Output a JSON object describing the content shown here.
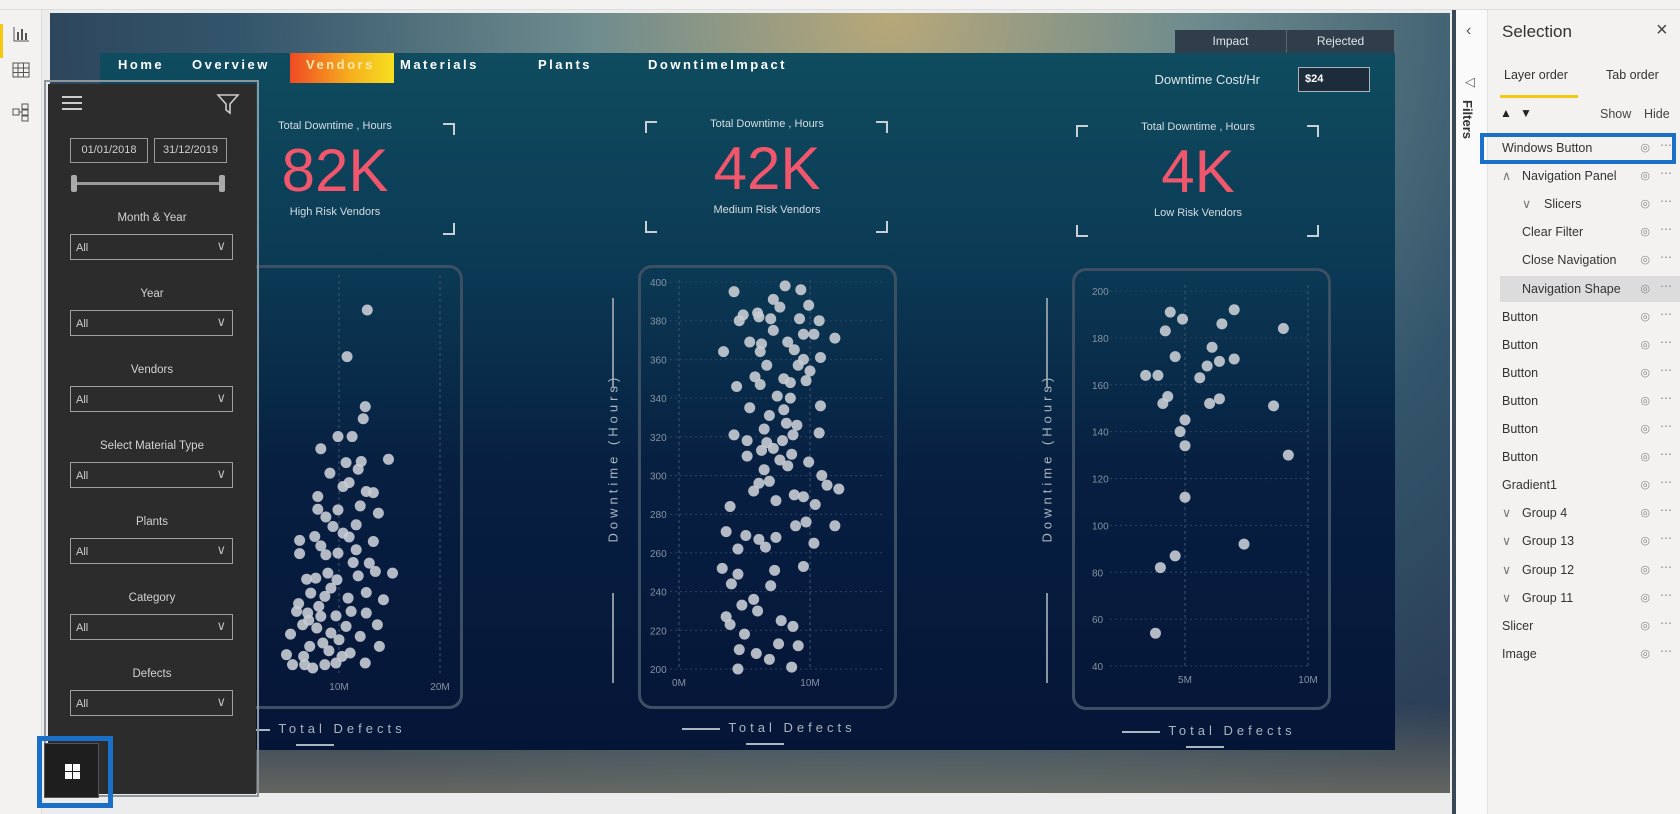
{
  "left_rail": {
    "icons": [
      "report-view-icon",
      "data-view-icon",
      "model-view-icon"
    ],
    "active": "report-view-icon"
  },
  "report": {
    "nav": {
      "items": [
        "Home",
        "Overview",
        "Vendors",
        "Materials",
        "Plants",
        "DowntimeImpact"
      ],
      "active": "Vendors"
    },
    "tabs": [
      "Impact",
      "Rejected"
    ],
    "cost": {
      "label": "Downtime Cost/Hr",
      "value": "$24"
    },
    "kpis": [
      {
        "title": "Total Downtime , Hours",
        "value": "82K",
        "subtitle": "High Risk Vendors"
      },
      {
        "title": "Total Downtime , Hours",
        "value": "42K",
        "subtitle": "Medium Risk Vendors"
      },
      {
        "title": "Total Downtime , Hours",
        "value": "4K",
        "subtitle": "Low Risk Vendors"
      }
    ],
    "accent_color": "#f0566c",
    "active_tab_gradient": [
      "#f04a24",
      "#f7df1f"
    ]
  },
  "slicer_panel": {
    "date_from": "01/01/2018",
    "date_to": "31/12/2019",
    "slicers": [
      {
        "label": "Month & Year",
        "value": "All"
      },
      {
        "label": "Year",
        "value": "All"
      },
      {
        "label": "Vendors",
        "value": "All"
      },
      {
        "label": "Select Material Type",
        "value": "All"
      },
      {
        "label": "Plants",
        "value": "All"
      },
      {
        "label": "Category",
        "value": "All"
      },
      {
        "label": "Defects",
        "value": "All"
      }
    ]
  },
  "filters_pane": {
    "label": "Filters"
  },
  "selection_pane": {
    "title": "Selection",
    "tabs": [
      "Layer order",
      "Tab order"
    ],
    "active_tab": "Layer order",
    "show_label": "Show",
    "hide_label": "Hide",
    "items": [
      {
        "label": "Windows Button",
        "indent": 0,
        "chevron": "",
        "selected": true
      },
      {
        "label": "Navigation Panel",
        "indent": 1,
        "chevron": "^"
      },
      {
        "label": "Slicers",
        "indent": 2,
        "chevron": "v"
      },
      {
        "label": "Clear Filter",
        "indent": 1,
        "chevron": ""
      },
      {
        "label": "Close Navigation",
        "indent": 1,
        "chevron": ""
      },
      {
        "label": "Navigation Shape",
        "indent": 1,
        "chevron": "",
        "shaded": true
      },
      {
        "label": "Button",
        "indent": 0,
        "chevron": ""
      },
      {
        "label": "Button",
        "indent": 0,
        "chevron": ""
      },
      {
        "label": "Button",
        "indent": 0,
        "chevron": ""
      },
      {
        "label": "Button",
        "indent": 0,
        "chevron": ""
      },
      {
        "label": "Button",
        "indent": 0,
        "chevron": ""
      },
      {
        "label": "Button",
        "indent": 0,
        "chevron": ""
      },
      {
        "label": "Gradient1",
        "indent": 0,
        "chevron": ""
      },
      {
        "label": "Group 4",
        "indent": 0,
        "chevron": "v"
      },
      {
        "label": "Group 13",
        "indent": 0,
        "chevron": "v"
      },
      {
        "label": "Group 12",
        "indent": 0,
        "chevron": "v"
      },
      {
        "label": "Group 11",
        "indent": 0,
        "chevron": "v"
      },
      {
        "label": "Slicer",
        "indent": 0,
        "chevron": ""
      },
      {
        "label": "Image",
        "indent": 0,
        "chevron": ""
      }
    ]
  },
  "chart_data": [
    {
      "type": "scatter",
      "title": "",
      "xlabel": "Total Defects",
      "ylabel": "",
      "xticks": [
        "10M",
        "20M"
      ],
      "yticks": [],
      "xlim": [
        0,
        20
      ],
      "ylim": [
        0,
        1308
      ],
      "grid": true,
      "point_color": "#c8ccd4",
      "points": [
        [
          12.8,
          1308
        ],
        [
          10.8,
          1140
        ],
        [
          12.6,
          960
        ],
        [
          12.4,
          916
        ],
        [
          9.9,
          852
        ],
        [
          11.3,
          852
        ],
        [
          8.2,
          808
        ],
        [
          14.9,
          770
        ],
        [
          10.7,
          758
        ],
        [
          12.2,
          762
        ],
        [
          11.9,
          734
        ],
        [
          9.1,
          720
        ],
        [
          11.0,
          686
        ],
        [
          10.4,
          672
        ],
        [
          7.9,
          636
        ],
        [
          12.7,
          654
        ],
        [
          13.4,
          650
        ],
        [
          12.1,
          602
        ],
        [
          13.9,
          576
        ],
        [
          7.9,
          590
        ],
        [
          9.9,
          588
        ],
        [
          8.7,
          562
        ],
        [
          9.4,
          528
        ],
        [
          11.7,
          534
        ],
        [
          7.6,
          492
        ],
        [
          10.4,
          504
        ],
        [
          6.1,
          478
        ],
        [
          13.4,
          474
        ],
        [
          8.2,
          458
        ],
        [
          11.0,
          490
        ],
        [
          11.7,
          444
        ],
        [
          6.1,
          430
        ],
        [
          8.7,
          426
        ],
        [
          9.9,
          432
        ],
        [
          11.4,
          398
        ],
        [
          13.0,
          396
        ],
        [
          15.3,
          360
        ],
        [
          8.9,
          360
        ],
        [
          6.8,
          338
        ],
        [
          7.7,
          342
        ],
        [
          9.8,
          336
        ],
        [
          11.9,
          350
        ],
        [
          13.6,
          366
        ],
        [
          9.2,
          306
        ],
        [
          12.7,
          290
        ],
        [
          14.4,
          264
        ],
        [
          7.2,
          288
        ],
        [
          8.6,
          276
        ],
        [
          10.9,
          270
        ],
        [
          5.8,
          222
        ],
        [
          6.9,
          216
        ],
        [
          8.2,
          204
        ],
        [
          9.7,
          206
        ],
        [
          11.2,
          222
        ],
        [
          12.7,
          216
        ],
        [
          13.8,
          174
        ],
        [
          6.4,
          174
        ],
        [
          7.8,
          162
        ],
        [
          9.2,
          144
        ],
        [
          10.7,
          168
        ],
        [
          12.1,
          132
        ],
        [
          14.0,
          96
        ],
        [
          4.8,
          66
        ],
        [
          5.4,
          30
        ],
        [
          6.6,
          30
        ],
        [
          7.4,
          18
        ],
        [
          8.6,
          30
        ],
        [
          9.7,
          36
        ],
        [
          11.1,
          72
        ],
        [
          12.6,
          36
        ],
        [
          7.1,
          96
        ],
        [
          8.4,
          108
        ],
        [
          6.0,
          250
        ],
        [
          7.0,
          190
        ],
        [
          8.0,
          240
        ],
        [
          10.0,
          120
        ],
        [
          6.5,
          60
        ],
        [
          9.0,
          80
        ],
        [
          10.3,
          60
        ],
        [
          5.2,
          140
        ]
      ]
    },
    {
      "type": "scatter",
      "title": "",
      "xlabel": "Total Defects",
      "ylabel": "Downtime (Hours)",
      "xticks": [
        "0M",
        "10M"
      ],
      "yticks": [
        "200",
        "220",
        "240",
        "260",
        "280",
        "300",
        "320",
        "340",
        "360",
        "380",
        "400"
      ],
      "xlim": [
        0,
        10
      ],
      "ylim": [
        200,
        400
      ],
      "grid": true,
      "point_color": "#c8ccd4",
      "points": [
        [
          4.2,
          395
        ],
        [
          8.1,
          398
        ],
        [
          9.3,
          396
        ],
        [
          7.2,
          391
        ],
        [
          7.7,
          387
        ],
        [
          9.9,
          388
        ],
        [
          4.9,
          383
        ],
        [
          4.6,
          380
        ],
        [
          6.0,
          384
        ],
        [
          6.1,
          382
        ],
        [
          7.0,
          381
        ],
        [
          9.2,
          381
        ],
        [
          10.7,
          380
        ],
        [
          7.2,
          375
        ],
        [
          10.3,
          373
        ],
        [
          9.5,
          373
        ],
        [
          11.9,
          371
        ],
        [
          5.4,
          369
        ],
        [
          6.3,
          368
        ],
        [
          8.3,
          369
        ],
        [
          8.8,
          365
        ],
        [
          3.4,
          364
        ],
        [
          6.2,
          364
        ],
        [
          10.8,
          361
        ],
        [
          9.5,
          360
        ],
        [
          9.1,
          357
        ],
        [
          6.7,
          357
        ],
        [
          10.0,
          354
        ],
        [
          5.8,
          351
        ],
        [
          8.0,
          350
        ],
        [
          9.7,
          349
        ],
        [
          4.4,
          346
        ],
        [
          6.2,
          347
        ],
        [
          8.5,
          348
        ],
        [
          7.5,
          341
        ],
        [
          8.5,
          340
        ],
        [
          5.4,
          335
        ],
        [
          8.0,
          334
        ],
        [
          10.8,
          336
        ],
        [
          6.9,
          331
        ],
        [
          8.2,
          327
        ],
        [
          9.0,
          326
        ],
        [
          6.5,
          324
        ],
        [
          4.2,
          321
        ],
        [
          10.7,
          322
        ],
        [
          8.7,
          321
        ],
        [
          5.2,
          318
        ],
        [
          7.9,
          318
        ],
        [
          6.7,
          317
        ],
        [
          6.3,
          313
        ],
        [
          7.2,
          314
        ],
        [
          8.6,
          311
        ],
        [
          5.2,
          310
        ],
        [
          7.7,
          308
        ],
        [
          9.9,
          307
        ],
        [
          8.3,
          305
        ],
        [
          6.5,
          303
        ],
        [
          10.9,
          300
        ],
        [
          6.9,
          297
        ],
        [
          11.3,
          295
        ],
        [
          12.2,
          293
        ],
        [
          6.1,
          296
        ],
        [
          5.7,
          292
        ],
        [
          8.8,
          290
        ],
        [
          9.5,
          289
        ],
        [
          10.4,
          285
        ],
        [
          7.4,
          287
        ],
        [
          3.9,
          284
        ],
        [
          8.9,
          274
        ],
        [
          9.7,
          276
        ],
        [
          11.9,
          274
        ],
        [
          3.6,
          271
        ],
        [
          5.1,
          269
        ],
        [
          6.1,
          267
        ],
        [
          7.4,
          268
        ],
        [
          6.6,
          263
        ],
        [
          4.5,
          262
        ],
        [
          10.3,
          265
        ],
        [
          3.3,
          252
        ],
        [
          9.5,
          253
        ],
        [
          7.3,
          251
        ],
        [
          4.5,
          249
        ],
        [
          4.0,
          244
        ],
        [
          7.0,
          243
        ],
        [
          5.7,
          236
        ],
        [
          4.8,
          233
        ],
        [
          6.0,
          230
        ],
        [
          3.6,
          227
        ],
        [
          3.9,
          223
        ],
        [
          7.8,
          225
        ],
        [
          8.7,
          222
        ],
        [
          5.0,
          218
        ],
        [
          7.6,
          213
        ],
        [
          9.1,
          212
        ],
        [
          4.6,
          210
        ],
        [
          5.9,
          208
        ],
        [
          6.9,
          205
        ],
        [
          8.6,
          201
        ],
        [
          4.5,
          200
        ]
      ]
    },
    {
      "type": "scatter",
      "title": "",
      "xlabel": "Total Defects",
      "ylabel": "Downtime (Hours)",
      "xticks": [
        "5M",
        "10M"
      ],
      "yticks": [
        "40",
        "60",
        "80",
        "100",
        "120",
        "140",
        "160",
        "180",
        "200"
      ],
      "xlim": [
        5,
        10
      ],
      "ylim": [
        40,
        200
      ],
      "grid": true,
      "point_color": "#c8ccd4",
      "points": [
        [
          4.4,
          191
        ],
        [
          4.9,
          188
        ],
        [
          4.2,
          183
        ],
        [
          7.0,
          192
        ],
        [
          6.5,
          186
        ],
        [
          9.0,
          184
        ],
        [
          6.1,
          176
        ],
        [
          4.6,
          172
        ],
        [
          5.9,
          168
        ],
        [
          6.4,
          170
        ],
        [
          7.0,
          171
        ],
        [
          3.4,
          164
        ],
        [
          3.9,
          164
        ],
        [
          5.6,
          163
        ],
        [
          4.3,
          155
        ],
        [
          4.1,
          152
        ],
        [
          6.0,
          152
        ],
        [
          6.4,
          154
        ],
        [
          8.6,
          151
        ],
        [
          5.0,
          145
        ],
        [
          4.8,
          140
        ],
        [
          5.0,
          134
        ],
        [
          9.2,
          130
        ],
        [
          5.0,
          112
        ],
        [
          7.4,
          92
        ],
        [
          4.6,
          87
        ],
        [
          4.0,
          82
        ],
        [
          3.8,
          54
        ]
      ]
    }
  ]
}
